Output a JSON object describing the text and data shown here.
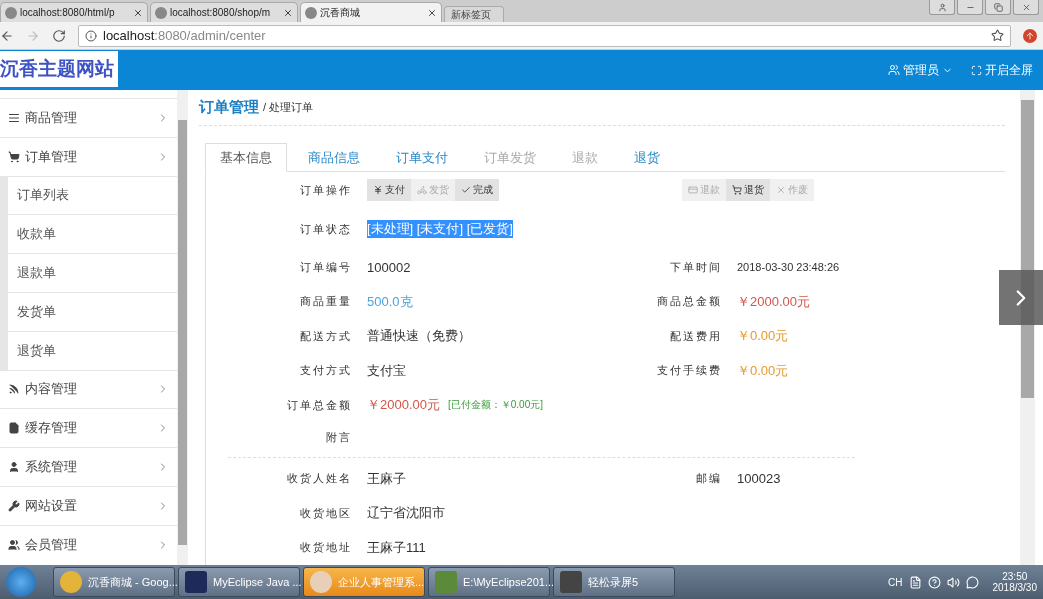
{
  "browser": {
    "tabs": [
      {
        "title": "localhost:8080/html/p",
        "selected": false
      },
      {
        "title": "localhost:8080/shop/m",
        "selected": false
      },
      {
        "title": "沉香商城",
        "selected": true
      },
      {
        "title": "新标签页",
        "selected": false
      }
    ],
    "address_host": "localhost",
    "address_path": ":8080/admin/center"
  },
  "header": {
    "logo": "沉香主题网站",
    "user": "管理员",
    "fullscreen": "开启全屏"
  },
  "sidebar": {
    "items": [
      {
        "label": "商品管理"
      },
      {
        "label": "订单管理",
        "children": [
          {
            "label": "订单列表"
          },
          {
            "label": "收款单"
          },
          {
            "label": "退款单"
          },
          {
            "label": "发货单"
          },
          {
            "label": "退货单"
          }
        ]
      },
      {
        "label": "内容管理"
      },
      {
        "label": "缓存管理"
      },
      {
        "label": "系统管理"
      },
      {
        "label": "网站设置"
      },
      {
        "label": "会员管理"
      }
    ]
  },
  "breadcrumb": {
    "section": "订单管理",
    "page": "/ 处理订单"
  },
  "tabs": [
    {
      "label": "基本信息",
      "selected": true,
      "disabled": false
    },
    {
      "label": "商品信息",
      "selected": false,
      "disabled": false
    },
    {
      "label": "订单支付",
      "selected": false,
      "disabled": false
    },
    {
      "label": "订单发货",
      "selected": false,
      "disabled": true
    },
    {
      "label": "退款",
      "selected": false,
      "disabled": true
    },
    {
      "label": "退货",
      "selected": false,
      "disabled": false
    }
  ],
  "actions": {
    "label": "订单操作",
    "left": [
      {
        "label": "支付",
        "disabled": false
      },
      {
        "label": "发货",
        "disabled": true
      },
      {
        "label": "完成",
        "disabled": false
      }
    ],
    "right": [
      {
        "label": "退款",
        "disabled": true
      },
      {
        "label": "退货",
        "disabled": false
      },
      {
        "label": "作废",
        "disabled": true
      }
    ]
  },
  "status": {
    "label": "订单状态",
    "value": "[未处理] [未支付] [已发货]",
    "highlighted": true
  },
  "sections": [
    [
      {
        "left": {
          "label": "订单编号",
          "value": "100002",
          "kind": "plain"
        },
        "right": {
          "label": "下单时间",
          "value": "2018-03-30 23:48:26",
          "kind": "small"
        }
      },
      {
        "left": {
          "label": "商品重量",
          "value": "500.0克",
          "kind": "weight"
        },
        "right": {
          "label": "商品总金额",
          "value": "￥2000.00元",
          "kind": "price"
        }
      },
      {
        "left": {
          "label": "配送方式",
          "value": "普通快速（免费）",
          "kind": "plain"
        },
        "right": {
          "label": "配送费用",
          "value": "￥0.00元",
          "kind": "fee"
        }
      },
      {
        "left": {
          "label": "支付方式",
          "value": "支付宝",
          "kind": "plain"
        },
        "right": {
          "label": "支付手续费",
          "value": "￥0.00元",
          "kind": "fee"
        }
      },
      {
        "left": {
          "label": "订单总金额",
          "value": "￥2000.00元",
          "kind": "price",
          "note": "[已付金额：￥0.00元]"
        }
      },
      {
        "left": {
          "label": "附言"
        }
      }
    ],
    [
      {
        "left": {
          "label": "收货人姓名",
          "value": "王麻子",
          "kind": "plain"
        },
        "right": {
          "label": "邮编",
          "value": "100023",
          "kind": "plain"
        }
      },
      {
        "left": {
          "label": "收货地区",
          "value": "辽宁省沈阳市",
          "kind": "plain"
        }
      },
      {
        "left": {
          "label": "收货地址",
          "value": "王麻子111",
          "kind": "plain"
        }
      }
    ]
  ],
  "taskbar": {
    "buttons": [
      {
        "label": "沉香商城 - Goog...",
        "highlighted": false
      },
      {
        "label": "MyEclipse Java ...",
        "highlighted": false
      },
      {
        "label": "企业人事管理系...",
        "highlighted": true
      },
      {
        "label": "E:\\MyEclipse201...",
        "highlighted": false
      },
      {
        "label": "轻松录屏5",
        "highlighted": false
      }
    ],
    "lang": "CH",
    "time": "23:50",
    "date": "2018/3/30"
  }
}
